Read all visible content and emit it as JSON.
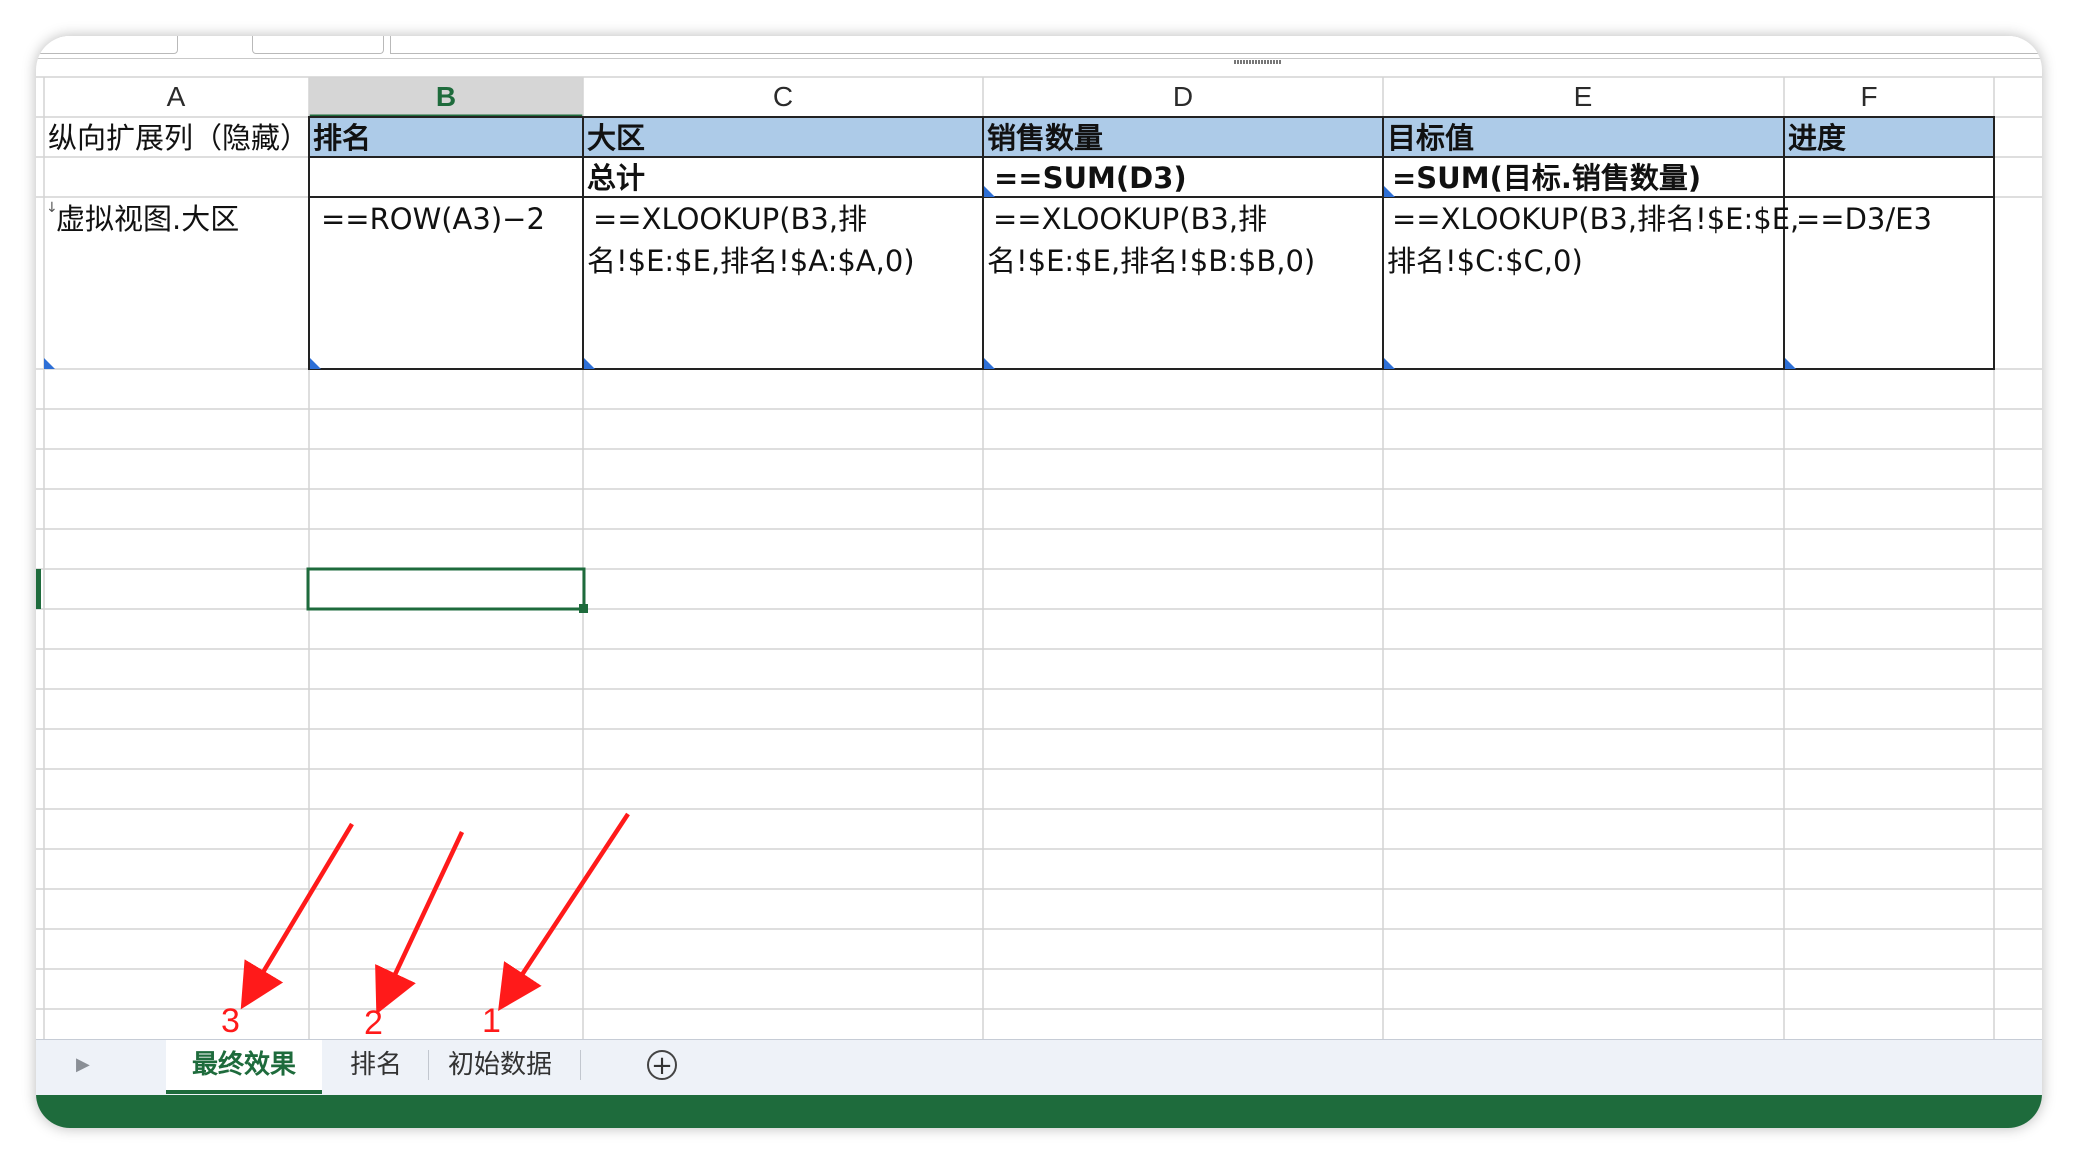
{
  "columns": [
    "A",
    "B",
    "C",
    "D",
    "E",
    "F"
  ],
  "header_row": {
    "A": "纵向扩展列（隐藏）",
    "B": "排名",
    "C": "大区",
    "D": "销售数量",
    "E": "目标值",
    "F": "进度"
  },
  "row2": {
    "C": "总计",
    "D": "==SUM(D3)",
    "E": "=SUM(目标.销售数量)"
  },
  "row3": {
    "A": "虚拟视图.大区",
    "B": "==ROW(A3)−2",
    "C_line1": "==XLOOKUP(B3,排",
    "C_line2": "名!$E:$E,排名!$A:$A,0)",
    "D_line1": "==XLOOKUP(B3,排",
    "D_line2": "名!$E:$E,排名!$B:$B,0)",
    "E_line1": "==XLOOKUP(B3,排名!$E:$E,",
    "E_line2": "排名!$C:$C,0)",
    "F": "==D3/E3"
  },
  "sheet_tabs": [
    {
      "label": "最终效果",
      "active": true
    },
    {
      "label": "排名",
      "active": false
    },
    {
      "label": "初始数据",
      "active": false
    }
  ],
  "annotations": [
    "3",
    "2",
    "1"
  ],
  "colors": {
    "header_fill": "#adcbe8",
    "accent_green": "#1e6b3c",
    "arrow_red": "#ff1a1a"
  },
  "icons": {
    "add_sheet": "plus-circle-icon",
    "nav": "chevron-right-icon"
  }
}
